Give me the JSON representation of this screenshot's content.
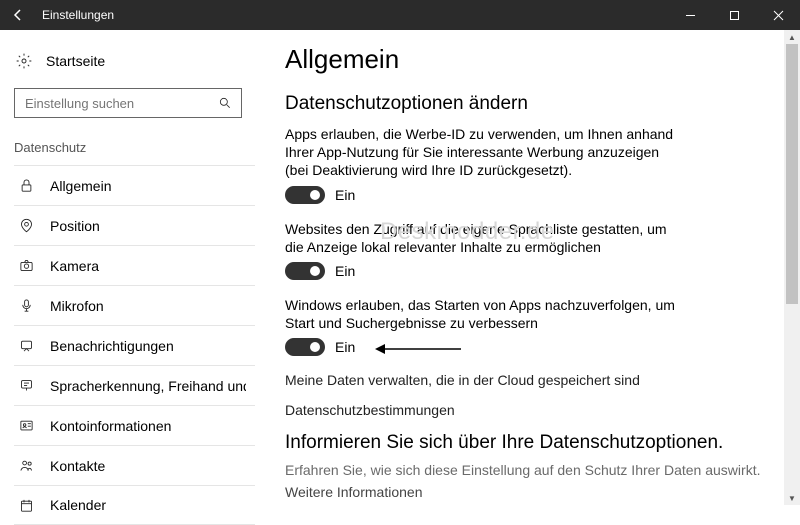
{
  "window": {
    "title": "Einstellungen"
  },
  "sidebar": {
    "home": "Startseite",
    "search_placeholder": "Einstellung suchen",
    "section": "Datenschutz",
    "items": [
      {
        "label": "Allgemein",
        "icon": "lock-icon"
      },
      {
        "label": "Position",
        "icon": "location-icon"
      },
      {
        "label": "Kamera",
        "icon": "camera-icon"
      },
      {
        "label": "Mikrofon",
        "icon": "microphone-icon"
      },
      {
        "label": "Benachrichtigungen",
        "icon": "notification-icon"
      },
      {
        "label": "Spracherkennung, Freihand und Eingabe",
        "icon": "speech-icon"
      },
      {
        "label": "Kontoinformationen",
        "icon": "account-icon"
      },
      {
        "label": "Kontakte",
        "icon": "contacts-icon"
      },
      {
        "label": "Kalender",
        "icon": "calendar-icon"
      }
    ]
  },
  "main": {
    "title": "Allgemein",
    "section1_title": "Datenschutzoptionen ändern",
    "option1": {
      "desc": "Apps erlauben, die Werbe-ID zu verwenden, um Ihnen anhand Ihrer App-Nutzung für Sie interessante Werbung anzuzeigen (bei Deaktivierung wird Ihre ID zurückgesetzt).",
      "state": "Ein"
    },
    "option2": {
      "desc": "Websites den Zugriff auf die eigene Sprachliste gestatten, um die Anzeige lokal relevanter Inhalte zu ermöglichen",
      "state": "Ein"
    },
    "option3": {
      "desc": "Windows erlauben, das Starten von Apps nachzuverfolgen, um Start und Suchergebnisse zu verbessern",
      "state": "Ein"
    },
    "link1": "Meine Daten verwalten, die in der Cloud gespeichert sind",
    "link2": "Datenschutzbestimmungen",
    "section2_title": "Informieren Sie sich über Ihre Datenschutzoptionen.",
    "section2_desc": "Erfahren Sie, wie sich diese Einstellung auf den Schutz Ihrer Daten auswirkt.",
    "section2_link": "Weitere Informationen"
  },
  "watermark": "Deskmodder.de"
}
